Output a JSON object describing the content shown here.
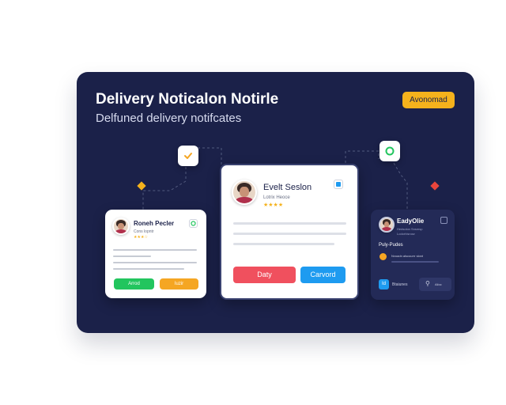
{
  "header": {
    "title": "Delivery Noticalon Notirle",
    "subtitle": "Delfuned delivery notifcates",
    "badge": "Avonomad"
  },
  "colors": {
    "panel": "#1b2149",
    "badge": "#f5b21c",
    "green": "#22c55e",
    "orange": "#f5a623",
    "red": "#f0505e",
    "blue": "#1e9bf0",
    "diamond_left": "#f5b21c",
    "diamond_right": "#e8453c"
  },
  "icons": {
    "top_left": "check-icon",
    "top_right": "status-ring-icon",
    "badge_small": "shield-icon"
  },
  "left_card": {
    "name": "Roneh Pecler",
    "meta": "Cons lopntr",
    "stars": "★★★☆",
    "accept_label": "Arrod",
    "other_label": "Iuzir"
  },
  "center_card": {
    "name": "Evelt Seslon",
    "meta": "Lotrix Heoce",
    "stars": "★★★★",
    "decline_label": "Daty",
    "confirm_label": "Carvord"
  },
  "right_card": {
    "name": "EadyOlie",
    "meta": "Hedsolon Snsmsp",
    "meta2": "Lodorhisnow",
    "section": "Puly-Pudes",
    "item": "Nvoadn alscourrr slont",
    "footer_badge": "Id",
    "footer_text": "Btaiunes",
    "footer_right": "Ailoc"
  }
}
